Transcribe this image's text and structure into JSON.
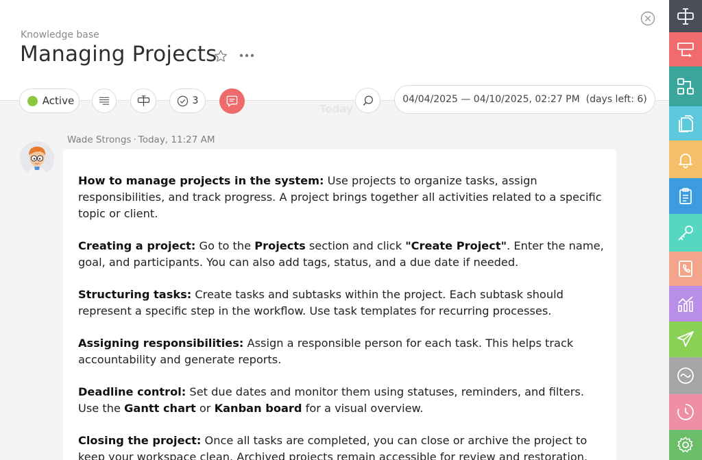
{
  "header": {
    "breadcrumb": "Knowledge base",
    "title": "Managing Projects"
  },
  "toolbar": {
    "status_label": "Active",
    "status_color": "#8cc63f",
    "checklist_count": "3",
    "date_range": "04/04/2025 — 04/10/2025, 02:27 PM  (days left: 6)",
    "accent_color": "#ef6a6a"
  },
  "feed": {
    "day_separator": "Today"
  },
  "message": {
    "author": "Wade Strongs",
    "separator": "·",
    "time": "Today, 11:27 AM",
    "paragraphs": [
      {
        "lead": "How to manage projects in the system:",
        "text": " Use projects to organize tasks, assign responsibilities, and track progress. A project brings together all activities related to a specific topic or client."
      },
      {
        "lead": "Creating a project:",
        "t1": " Go to the ",
        "b1": "Projects",
        "t2": " section and click ",
        "b2": "\"Create Project\"",
        "t3": ". Enter the name, goal, and participants. You can also add tags, status, and a due date if needed."
      },
      {
        "lead": "Structuring tasks:",
        "text": " Create tasks and subtasks within the project. Each subtask should represent a specific step in the workflow. Use task templates for recurring processes."
      },
      {
        "lead": "Assigning responsibilities:",
        "text": " Assign a responsible person for each task. This helps track accountability and generate reports."
      },
      {
        "lead": "Deadline control:",
        "t1": " Set due dates and monitor them using statuses, reminders, and filters. Use the ",
        "b1": "Gantt chart",
        "t2": " or ",
        "b2": "Kanban board",
        "t3": " for a visual overview."
      },
      {
        "lead": "Closing the project:",
        "text": " Once all tasks are completed, you can close or archive the project to keep your workspace clean. Archived projects remain accessible for review and restoration."
      }
    ]
  },
  "sidebar": {
    "items": [
      {
        "icon": "pin-board-icon",
        "color": "#4a4d57"
      },
      {
        "icon": "window-icon",
        "color": "#f06b6b"
      },
      {
        "icon": "hierarchy-icon",
        "color": "#3aa59a"
      },
      {
        "icon": "documents-icon",
        "color": "#5ec9dc"
      },
      {
        "icon": "bell-icon",
        "color": "#f5bf6a"
      },
      {
        "icon": "clipboard-icon",
        "color": "#3d9be0"
      },
      {
        "icon": "key-icon",
        "color": "#54d8c2"
      },
      {
        "icon": "phone-book-icon",
        "color": "#f4a48a"
      },
      {
        "icon": "analytics-icon",
        "color": "#b98ee6"
      },
      {
        "icon": "send-icon",
        "color": "#8ad156"
      },
      {
        "icon": "wave-icon",
        "color": "#a6a6a6"
      },
      {
        "icon": "clock-icon",
        "color": "#ef8fa6"
      },
      {
        "icon": "gear-icon",
        "color": "#6cbd6a"
      }
    ]
  }
}
